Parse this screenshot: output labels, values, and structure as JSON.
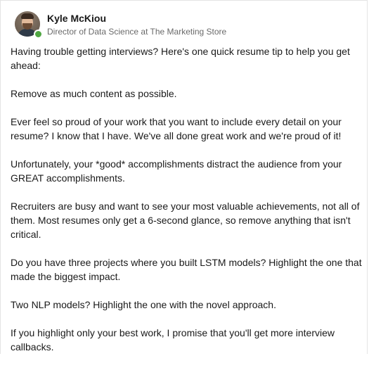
{
  "post": {
    "author": {
      "name": "Kyle McKiou",
      "headline": "Director of Data Science at The Marketing Store",
      "status": "online",
      "presence_color": "#4fa642"
    },
    "paragraphs": [
      "Having trouble getting interviews?  Here's one quick resume tip to help you get ahead:",
      "Remove as much content as possible.",
      "Ever feel so proud of your work that you want to include every detail on your resume?  I know that I have.  We've all done great work and we're proud of it!",
      "Unfortunately, your *good* accomplishments distract the audience from your GREAT accomplishments.",
      "Recruiters are busy and want to see your most valuable achievements, not all of them.  Most resumes only get a 6-second glance, so remove anything that isn't critical.",
      "Do you have three projects where you built LSTM models? Highlight the one that made the biggest impact.",
      "Two NLP models? Highlight the one with the novel approach.",
      "If you highlight only your best work, I promise that you'll get more interview callbacks."
    ]
  }
}
